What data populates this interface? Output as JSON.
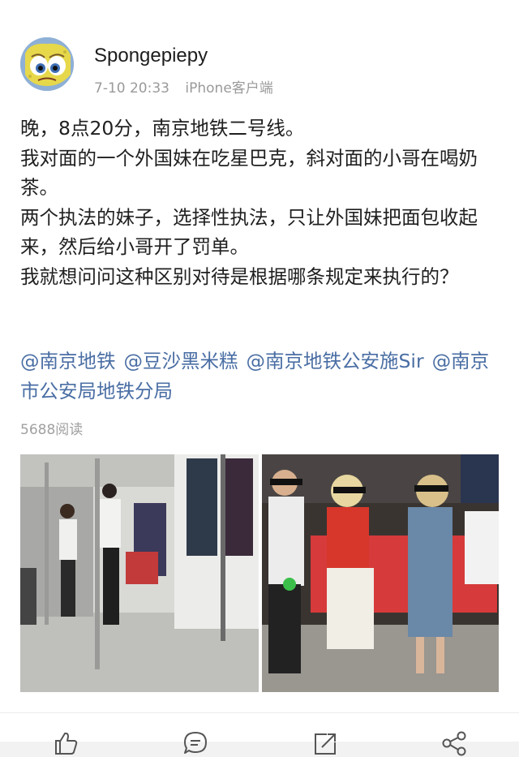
{
  "post": {
    "author": "Spongepiepy",
    "time": "7-10 20:33",
    "source": "iPhone客户端",
    "lines": [
      "晚，8点20分，南京地铁二号线。",
      "我对面的一个外国妹在吃星巴克，斜对面的小哥在喝奶茶。",
      "两个执法的妹子，选择性执法，只让外国妹把面包收起来，然后给小哥开了罚单。",
      "我就想问问这种区别对待是根据哪条规定来执行的？"
    ],
    "mentions": [
      "@南京地铁",
      "@豆沙黑米糕",
      "@南京地铁公安施Sir",
      "@南京市公安局地铁分局"
    ],
    "reads": "5688阅读"
  },
  "images": [
    {
      "name": "subway-car-interior-photo",
      "icon": "photo"
    },
    {
      "name": "passengers-seated-photo",
      "icon": "photo"
    }
  ],
  "actions": [
    {
      "name": "like-button",
      "icon": "thumbs-up-icon"
    },
    {
      "name": "comment-button",
      "icon": "comment-icon"
    },
    {
      "name": "repost-button",
      "icon": "repost-icon"
    },
    {
      "name": "share-button",
      "icon": "share-icon"
    }
  ],
  "colors": {
    "mention": "#4a6ea4",
    "text": "#1f1f1f",
    "meta": "#9a9a9a"
  }
}
